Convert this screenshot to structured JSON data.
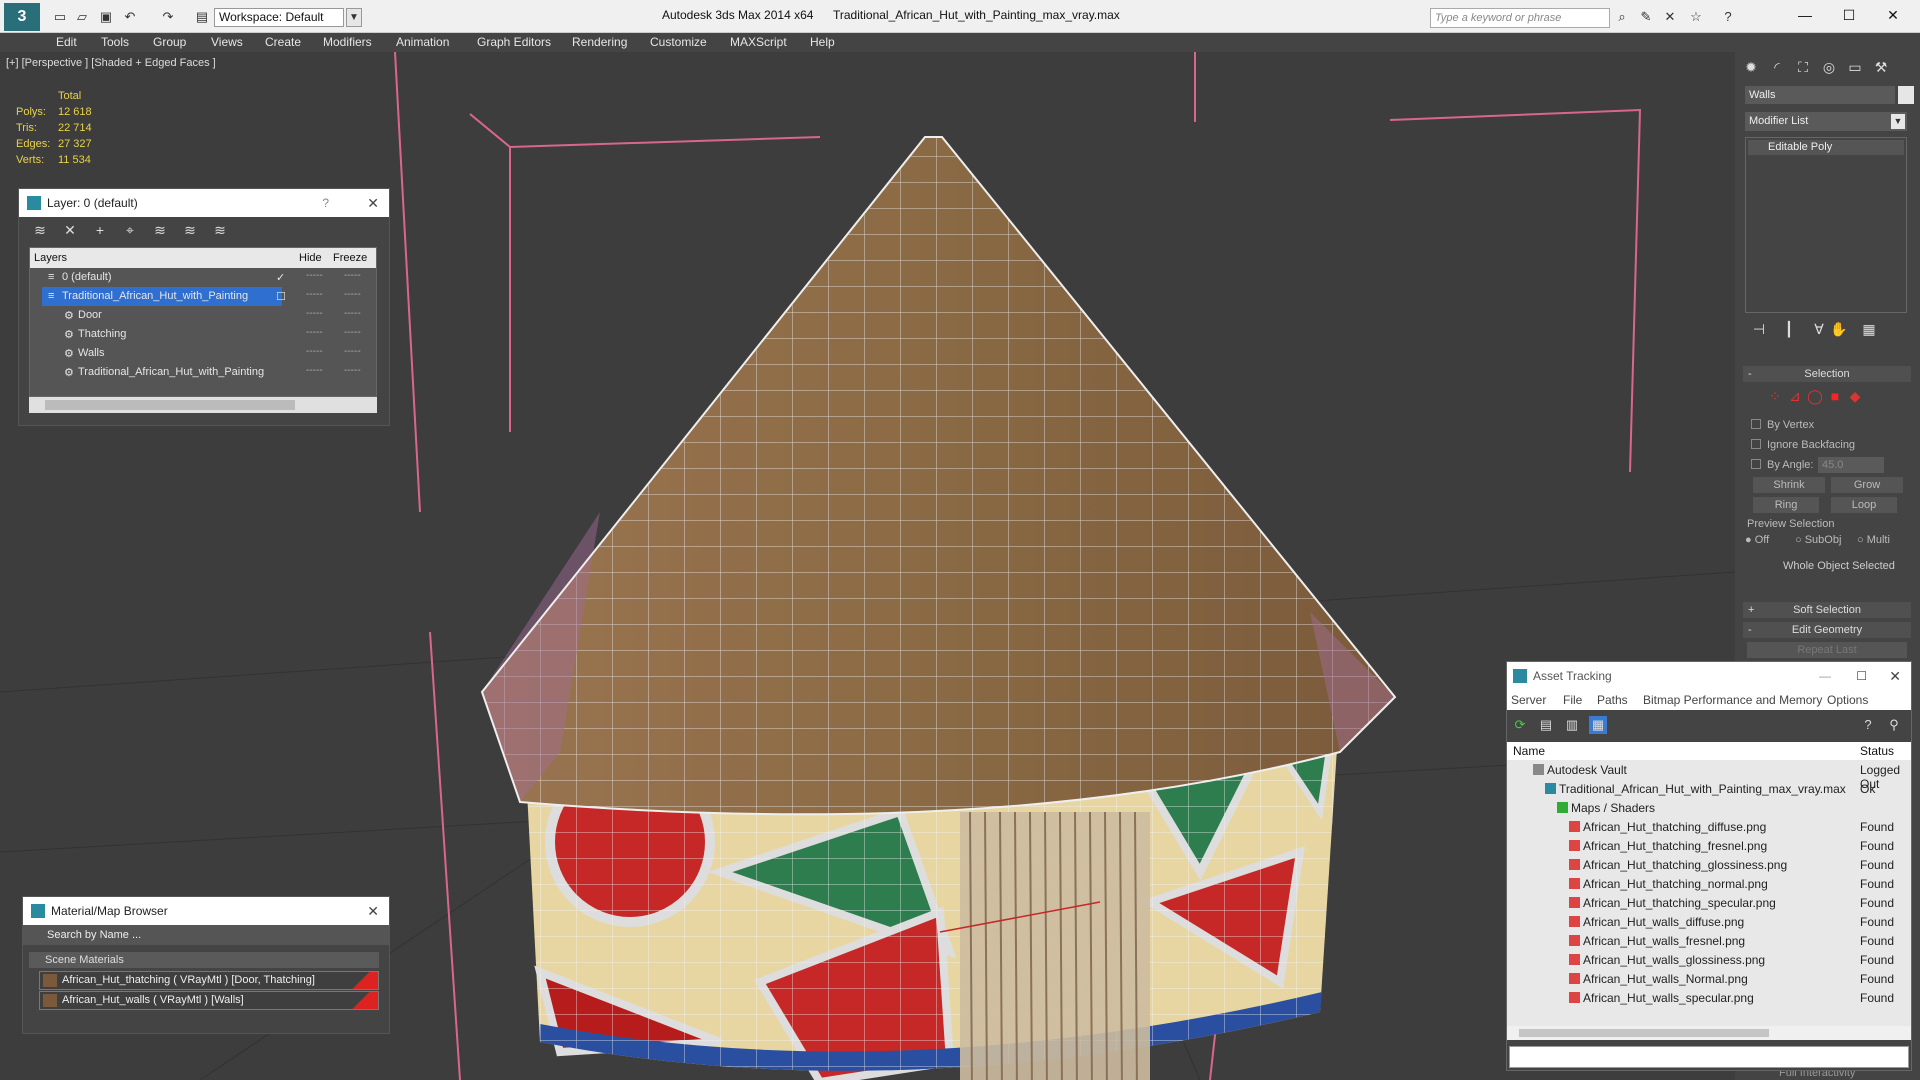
{
  "titlebar": {
    "workspace": "Workspace: Default",
    "app_title": "Autodesk 3ds Max  2014 x64",
    "file_title": "Traditional_African_Hut_with_Painting_max_vray.max",
    "search_placeholder": "Type a keyword or phrase"
  },
  "menu": [
    "Edit",
    "Tools",
    "Group",
    "Views",
    "Create",
    "Modifiers",
    "Animation",
    "Graph Editors",
    "Rendering",
    "Customize",
    "MAXScript",
    "Help"
  ],
  "viewport": {
    "label": "[+] [Perspective ] [Shaded + Edged Faces ]",
    "stats_header": "Total",
    "stats": [
      {
        "k": "Polys:",
        "v": "12 618"
      },
      {
        "k": "Tris:",
        "v": "22 714"
      },
      {
        "k": "Edges:",
        "v": "27 327"
      },
      {
        "k": "Verts:",
        "v": "11 534"
      }
    ]
  },
  "layer_panel": {
    "title": "Layer: 0 (default)",
    "help": "?",
    "col_layers": "Layers",
    "col_hide": "Hide",
    "col_freeze": "Freeze",
    "rows": [
      {
        "name": "0 (default)"
      },
      {
        "name": "Traditional_African_Hut_with_Painting"
      },
      {
        "name": "Door"
      },
      {
        "name": "Thatching"
      },
      {
        "name": "Walls"
      },
      {
        "name": "Traditional_African_Hut_with_Painting"
      }
    ]
  },
  "material_browser": {
    "title": "Material/Map Browser",
    "search": "Search by Name ...",
    "group": "Scene Materials",
    "items": [
      "African_Hut_thatching  ( VRayMtl ) [Door, Thatching]",
      "African_Hut_walls  ( VRayMtl ) [Walls]"
    ]
  },
  "command_panel": {
    "object_name": "Walls",
    "modifier_list": "Modifier List",
    "stack_item": "Editable Poly",
    "selection_title": "Selection",
    "by_vertex": "By Vertex",
    "ignore_backfacing": "Ignore Backfacing",
    "by_angle": "By Angle:",
    "angle_value": "45.0",
    "shrink": "Shrink",
    "grow": "Grow",
    "ring": "Ring",
    "loop": "Loop",
    "preview_selection": "Preview Selection",
    "off": "Off",
    "subobj": "SubObj",
    "multi": "Multi",
    "whole_object": "Whole Object Selected",
    "soft_selection": "Soft Selection",
    "edit_geometry": "Edit Geometry",
    "repeat_last": "Repeat Last",
    "full_interactivity": "Full Interactivity"
  },
  "asset_tracking": {
    "title": "Asset Tracking",
    "menu": [
      "Server",
      "File",
      "Paths",
      "Bitmap Performance and Memory",
      "Options"
    ],
    "col_name": "Name",
    "col_status": "Status",
    "rows": [
      {
        "name": "Autodesk Vault",
        "status": "Logged Out",
        "level": 1,
        "icon": "vault"
      },
      {
        "name": "Traditional_African_Hut_with_Painting_max_vray.max",
        "status": "Ok",
        "level": 2,
        "icon": "max"
      },
      {
        "name": "Maps / Shaders",
        "status": "",
        "level": 3,
        "icon": "maps"
      },
      {
        "name": "African_Hut_thatching_diffuse.png",
        "status": "Found",
        "level": 4,
        "icon": "png"
      },
      {
        "name": "African_Hut_thatching_fresnel.png",
        "status": "Found",
        "level": 4,
        "icon": "png"
      },
      {
        "name": "African_Hut_thatching_glossiness.png",
        "status": "Found",
        "level": 4,
        "icon": "png"
      },
      {
        "name": "African_Hut_thatching_normal.png",
        "status": "Found",
        "level": 4,
        "icon": "png"
      },
      {
        "name": "African_Hut_thatching_specular.png",
        "status": "Found",
        "level": 4,
        "icon": "png"
      },
      {
        "name": "African_Hut_walls_diffuse.png",
        "status": "Found",
        "level": 4,
        "icon": "png"
      },
      {
        "name": "African_Hut_walls_fresnel.png",
        "status": "Found",
        "level": 4,
        "icon": "png"
      },
      {
        "name": "African_Hut_walls_glossiness.png",
        "status": "Found",
        "level": 4,
        "icon": "png"
      },
      {
        "name": "African_Hut_walls_Normal.png",
        "status": "Found",
        "level": 4,
        "icon": "png"
      },
      {
        "name": "African_Hut_walls_specular.png",
        "status": "Found",
        "level": 4,
        "icon": "png"
      }
    ]
  }
}
